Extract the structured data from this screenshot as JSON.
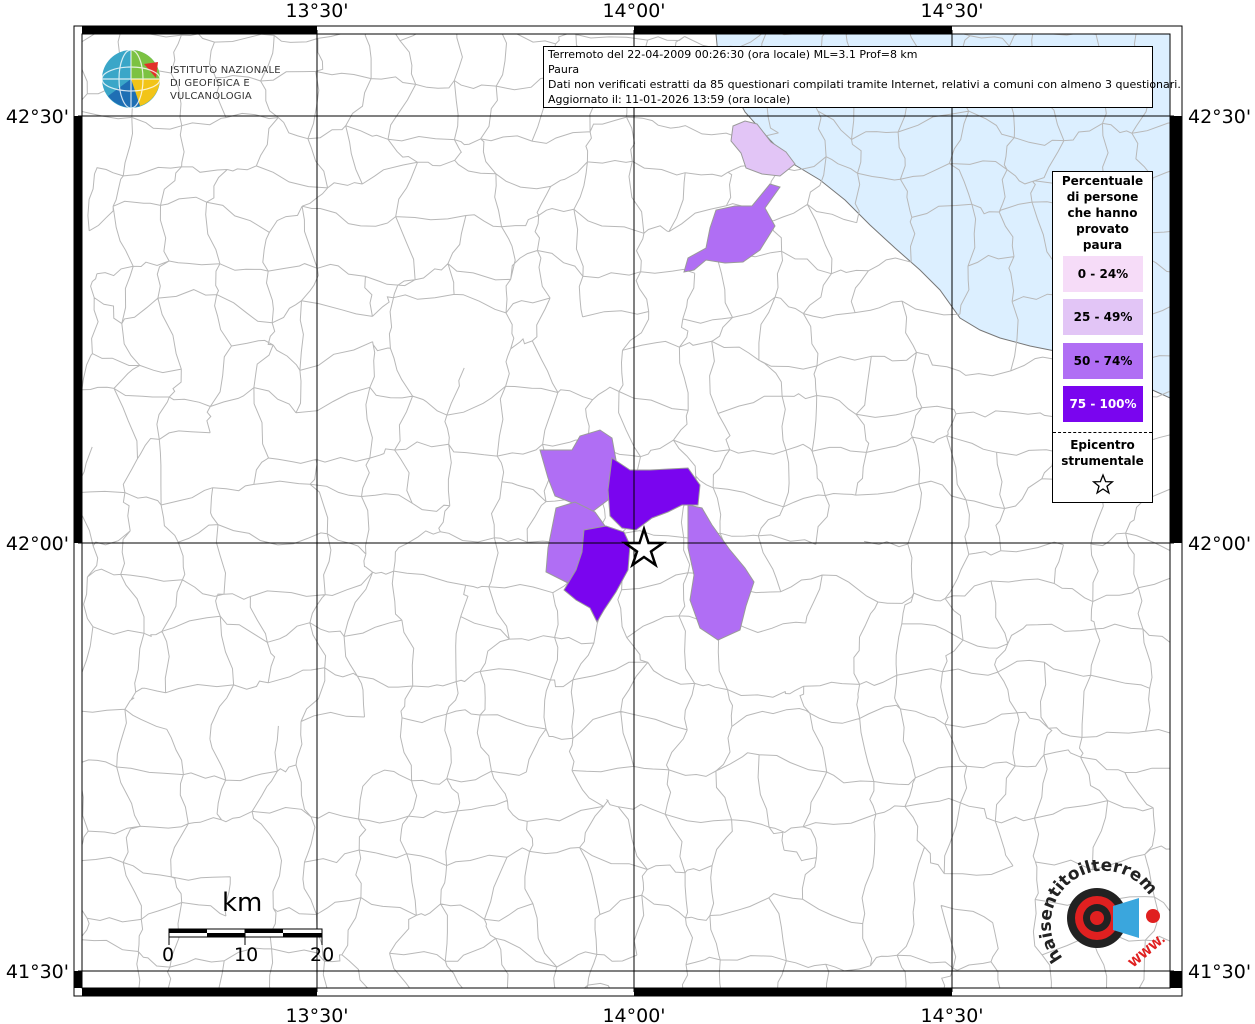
{
  "info": {
    "line1": "Terremoto del 22-04-2009 00:26:30 (ora locale) ML=3.1 Prof=8 km",
    "line2": "Paura",
    "line3": "Dati non verificati estratti da 85 questionari compilati tramite Internet, relativi a comuni con almeno 3 questionari.",
    "line4": "Aggiornato il: 11-01-2026 13:59 (ora locale)"
  },
  "ingv_logo": {
    "line1": "ISTITUTO NAZIONALE",
    "line2": "DI GEOFISICA E VULCANOLOGIA"
  },
  "axes": {
    "lon_top": [
      "13°30'",
      "14°00'",
      "14°30'"
    ],
    "lon_bottom": [
      "13°30'",
      "14°00'",
      "14°30'"
    ],
    "lat_left": [
      "42°30'",
      "42°00'",
      "41°30'"
    ],
    "lat_right": [
      "42°30'",
      "42°00'",
      "41°30'"
    ]
  },
  "legend": {
    "title_lines": [
      "Percentuale",
      "di persone",
      "che hanno",
      "provato",
      "paura"
    ],
    "classes": [
      {
        "label": "0 - 24%",
        "color": "#f6dcf8",
        "text_color": "#000000"
      },
      {
        "label": "25 - 49%",
        "color": "#e2c5f6",
        "text_color": "#000000"
      },
      {
        "label": "50 - 74%",
        "color": "#b06ef4",
        "text_color": "#000000"
      },
      {
        "label": "75 - 100%",
        "color": "#7a05ef",
        "text_color": "#ffffff"
      }
    ],
    "epicentre_lines": [
      "Epicentro",
      "strumentale"
    ]
  },
  "scale": {
    "title": "km",
    "ticks": [
      "0",
      "10",
      "20"
    ]
  },
  "watermark": {
    "brand": "haisentitoilterremoto.it",
    "url": "WWW."
  },
  "colors": {
    "sea": "#dcefff",
    "frame": "#000000",
    "grid": "#000000",
    "borders": "#b8b8b8"
  }
}
